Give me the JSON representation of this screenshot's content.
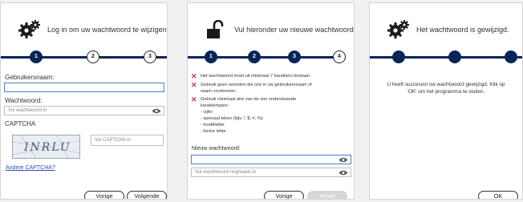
{
  "login": {
    "title": "Log in om uw wachtwoord te wijzigen.",
    "steps": [
      "1",
      "2",
      "3"
    ],
    "username_label": "Gebruikersnaam:",
    "username_value": "",
    "password_label": "Wachtwoord:",
    "password_placeholder": "Vul wachtwoord in",
    "captcha_label": "CAPTCHA",
    "captcha_image_text": "INRLU",
    "captcha_placeholder": "Vul CAPTCHA in",
    "other_captcha_link": "Andere CAPTCHA?",
    "prev_button": "Vorige",
    "next_button": "Volgende",
    "icon": "gears-icon"
  },
  "new_password": {
    "title": "Vul hieronder uw nieuwe wachtwoord in.",
    "steps": [
      "1",
      "2",
      "3",
      "4"
    ],
    "rules": [
      "Het wachtwoord moet uit minimaal 7 karakters bestaan.",
      "Gebruik geen woorden die ook in uw gebruikersnaam of\nnaam voorkomen.",
      "Gebruik minimaal drie van de vier onderstaande\nkaraktertypes:\n- cijfer\n- speciaal teken (bijv. !, $, #, %)\n- hoofdletter\n- kleine letter"
    ],
    "new_label": "Nieuw wachtwoord:",
    "new_value": "",
    "repeat_placeholder": "Vul wachtwoord nogmaals in",
    "prev_button": "Vorige",
    "reset_button": "Reset",
    "icon": "unlock-icon"
  },
  "success": {
    "title": "Het wachtwoord is gewijzigd.",
    "message": "U heeft succesvol uw wachtwoord gewijzigd. Klik op\n'OK' om het programma te sluiten.",
    "ok_button": "OK",
    "icon": "gears-icon"
  },
  "colors": {
    "accent": "#06265a",
    "error": "#d23a3a",
    "link": "#2a4fa8",
    "focus": "#4a7fd0"
  }
}
